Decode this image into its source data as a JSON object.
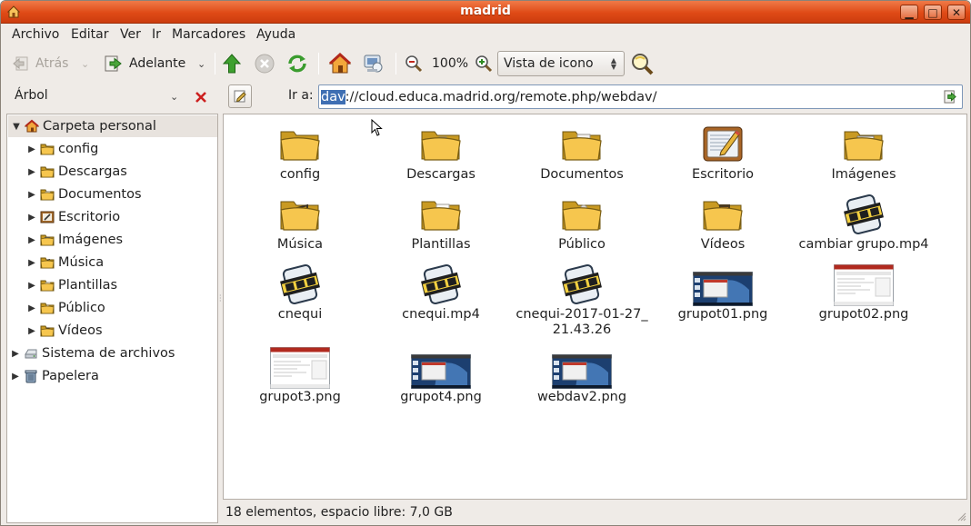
{
  "window": {
    "title": "madrid"
  },
  "menu": [
    "Archivo",
    "Editar",
    "Ver",
    "Ir",
    "Marcadores",
    "Ayuda"
  ],
  "toolbar": {
    "back_label": "Atrás",
    "forward_label": "Adelante",
    "zoom_level": "100%",
    "view_mode": "Vista de icono"
  },
  "location": {
    "pane_title": "Árbol",
    "go_label": "Ir a:",
    "url_selected": "dav",
    "url_rest": "://cloud.educa.madrid.org/remote.php/webdav/"
  },
  "sidebar": {
    "items": [
      {
        "label": "Carpeta personal",
        "icon": "home-folder-icon",
        "level": 0,
        "expanded": true,
        "selected": true
      },
      {
        "label": "config",
        "icon": "folder-icon",
        "level": 1
      },
      {
        "label": "Descargas",
        "icon": "downloads-folder-icon",
        "level": 1
      },
      {
        "label": "Documentos",
        "icon": "documents-folder-icon",
        "level": 1
      },
      {
        "label": "Escritorio",
        "icon": "desktop-folder-icon",
        "level": 1
      },
      {
        "label": "Imágenes",
        "icon": "pictures-folder-icon",
        "level": 1
      },
      {
        "label": "Música",
        "icon": "music-folder-icon",
        "level": 1
      },
      {
        "label": "Plantillas",
        "icon": "templates-folder-icon",
        "level": 1
      },
      {
        "label": "Público",
        "icon": "public-folder-icon",
        "level": 1
      },
      {
        "label": "Vídeos",
        "icon": "videos-folder-icon",
        "level": 1
      },
      {
        "label": "Sistema de archivos",
        "icon": "drive-icon",
        "level": 0
      },
      {
        "label": "Papelera",
        "icon": "trash-icon",
        "level": 0
      }
    ]
  },
  "files": [
    {
      "name": "config",
      "icon": "folder"
    },
    {
      "name": "Descargas",
      "icon": "folder-downloads"
    },
    {
      "name": "Documentos",
      "icon": "folder-documents"
    },
    {
      "name": "Escritorio",
      "icon": "desktop"
    },
    {
      "name": "Imágenes",
      "icon": "folder-pictures"
    },
    {
      "name": "Música",
      "icon": "folder-music"
    },
    {
      "name": "Plantillas",
      "icon": "folder-templates"
    },
    {
      "name": "Público",
      "icon": "folder-public"
    },
    {
      "name": "Vídeos",
      "icon": "folder-videos"
    },
    {
      "name": "cambiar grupo.mp4",
      "icon": "video"
    },
    {
      "name": "cnequi",
      "icon": "video"
    },
    {
      "name": "cnequi.mp4",
      "icon": "video"
    },
    {
      "name": "cnequi-2017-01-27_\n21.43.26",
      "icon": "video"
    },
    {
      "name": "grupot01.png",
      "icon": "image-dark"
    },
    {
      "name": "grupot02.png",
      "icon": "image-light"
    },
    {
      "name": "grupot3.png",
      "icon": "image-light"
    },
    {
      "name": "grupot4.png",
      "icon": "image-dark"
    },
    {
      "name": "webdav2.png",
      "icon": "image-dark"
    }
  ],
  "status": {
    "text": "18 elementos, espacio libre: 7,0 GB"
  },
  "colors": {
    "titlebar": "#df4a16",
    "folder": "#f6c64e",
    "selection": "#3f6fb3"
  }
}
